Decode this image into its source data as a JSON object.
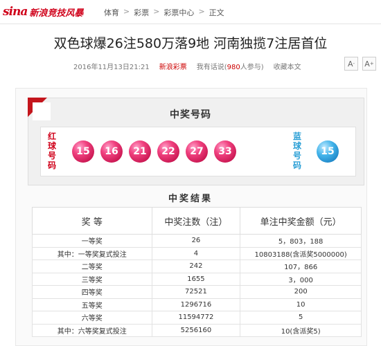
{
  "header": {
    "logo_mark": "sina",
    "logo_text": "新浪竞技风暴",
    "breadcrumb": [
      "体育",
      "彩票",
      "彩票中心",
      "正文"
    ],
    "breadcrumb_sep": ">"
  },
  "article": {
    "title": "双色球爆26注580万落9地 河南独揽7注居首位",
    "datetime": "2016年11月13日21:21",
    "source": "新浪彩票",
    "comment_prefix": "我有话说(",
    "comment_count": "980",
    "comment_suffix": "人参与)",
    "favorite": "收藏本文",
    "font_smaller": "A",
    "font_larger": "A",
    "font_smaller_sup": "-",
    "font_larger_sup": "+"
  },
  "winning_numbers": {
    "title": "中奖号码",
    "red_label": [
      "红",
      "球",
      "号",
      "码"
    ],
    "blue_label": [
      "蓝",
      "球",
      "号",
      "码"
    ],
    "red_balls": [
      "15",
      "16",
      "21",
      "22",
      "27",
      "33"
    ],
    "blue_balls": [
      "15"
    ],
    "colors": {
      "red": "#e8336f",
      "blue": "#2a9fd6",
      "accent": "#c4151c"
    }
  },
  "results": {
    "title": "中奖结果",
    "headers": [
      "奖 等",
      "中奖注数（注）",
      "单注中奖金额（元）"
    ],
    "rows": [
      [
        "一等奖",
        "26",
        "5，803，188"
      ],
      [
        "其中：一等奖复式投注",
        "4",
        "10803188(含派奖5000000)"
      ],
      [
        "二等奖",
        "242",
        "107，866"
      ],
      [
        "三等奖",
        "1655",
        "3，000"
      ],
      [
        "四等奖",
        "72521",
        "200"
      ],
      [
        "五等奖",
        "1296716",
        "10"
      ],
      [
        "六等奖",
        "11594772",
        "5"
      ],
      [
        "其中：六等奖复式投注",
        "5256160",
        "10(含派奖5)"
      ]
    ]
  }
}
